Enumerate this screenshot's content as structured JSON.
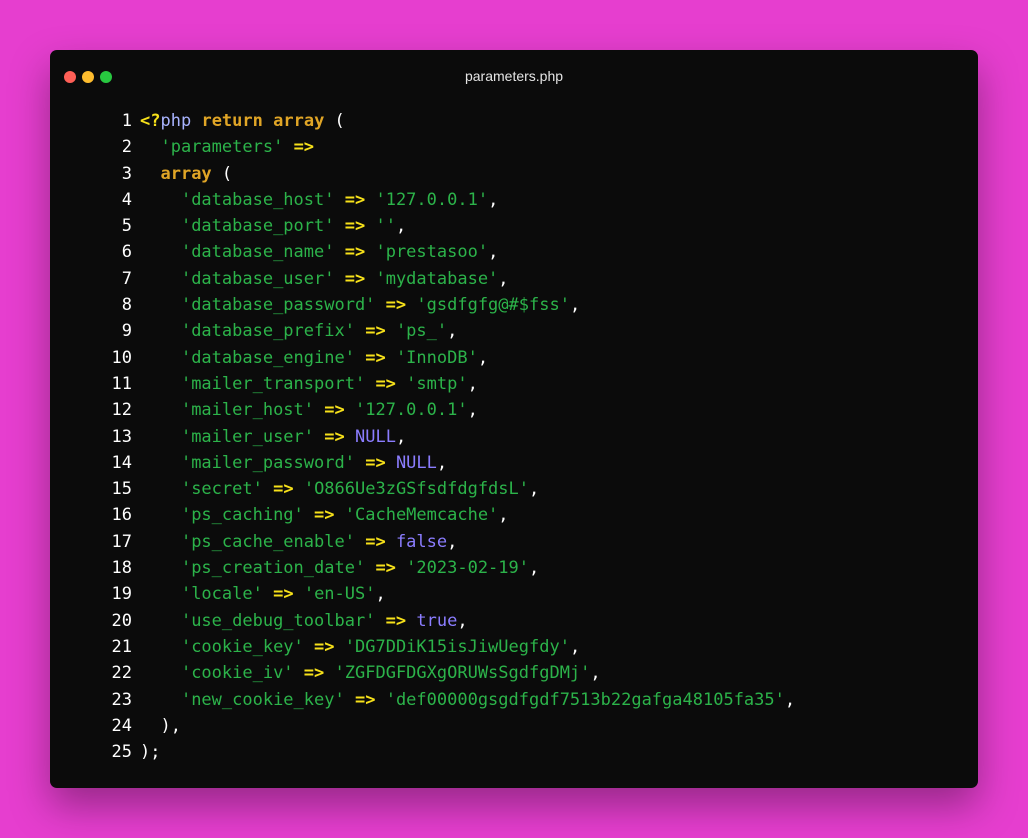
{
  "window": {
    "title": "parameters.php"
  },
  "colors": {
    "background": "#e63ecf",
    "window": "#0b0b0b",
    "string": "#2cb34a",
    "operator": "#f7e11a",
    "keyword": "#e0a526",
    "constant": "#8b7dff"
  },
  "code": {
    "lines": [
      {
        "n": "1",
        "tokens": [
          {
            "t": "<?",
            "c": "tag"
          },
          {
            "t": "php",
            "c": "php"
          },
          {
            "t": " ",
            "c": "punc"
          },
          {
            "t": "return",
            "c": "kw"
          },
          {
            "t": " ",
            "c": "punc"
          },
          {
            "t": "array",
            "c": "kw"
          },
          {
            "t": " (",
            "c": "punc"
          }
        ]
      },
      {
        "n": "2",
        "tokens": [
          {
            "t": "  ",
            "c": "punc"
          },
          {
            "t": "'parameters'",
            "c": "str"
          },
          {
            "t": " ",
            "c": "punc"
          },
          {
            "t": "=>",
            "c": "op"
          }
        ]
      },
      {
        "n": "3",
        "tokens": [
          {
            "t": "  ",
            "c": "punc"
          },
          {
            "t": "array",
            "c": "kw"
          },
          {
            "t": " (",
            "c": "punc"
          }
        ]
      },
      {
        "n": "4",
        "tokens": [
          {
            "t": "    ",
            "c": "punc"
          },
          {
            "t": "'database_host'",
            "c": "str"
          },
          {
            "t": " ",
            "c": "punc"
          },
          {
            "t": "=>",
            "c": "op"
          },
          {
            "t": " ",
            "c": "punc"
          },
          {
            "t": "'127.0.0.1'",
            "c": "str"
          },
          {
            "t": ",",
            "c": "punc"
          }
        ]
      },
      {
        "n": "5",
        "tokens": [
          {
            "t": "    ",
            "c": "punc"
          },
          {
            "t": "'database_port'",
            "c": "str"
          },
          {
            "t": " ",
            "c": "punc"
          },
          {
            "t": "=>",
            "c": "op"
          },
          {
            "t": " ",
            "c": "punc"
          },
          {
            "t": "''",
            "c": "str"
          },
          {
            "t": ",",
            "c": "punc"
          }
        ]
      },
      {
        "n": "6",
        "tokens": [
          {
            "t": "    ",
            "c": "punc"
          },
          {
            "t": "'database_name'",
            "c": "str"
          },
          {
            "t": " ",
            "c": "punc"
          },
          {
            "t": "=>",
            "c": "op"
          },
          {
            "t": " ",
            "c": "punc"
          },
          {
            "t": "'prestasoo'",
            "c": "str"
          },
          {
            "t": ",",
            "c": "punc"
          }
        ]
      },
      {
        "n": "7",
        "tokens": [
          {
            "t": "    ",
            "c": "punc"
          },
          {
            "t": "'database_user'",
            "c": "str"
          },
          {
            "t": " ",
            "c": "punc"
          },
          {
            "t": "=>",
            "c": "op"
          },
          {
            "t": " ",
            "c": "punc"
          },
          {
            "t": "'mydatabase'",
            "c": "str"
          },
          {
            "t": ",",
            "c": "punc"
          }
        ]
      },
      {
        "n": "8",
        "tokens": [
          {
            "t": "    ",
            "c": "punc"
          },
          {
            "t": "'database_password'",
            "c": "str"
          },
          {
            "t": " ",
            "c": "punc"
          },
          {
            "t": "=>",
            "c": "op"
          },
          {
            "t": " ",
            "c": "punc"
          },
          {
            "t": "'gsdfgfg@#$fss'",
            "c": "str"
          },
          {
            "t": ",",
            "c": "punc"
          }
        ]
      },
      {
        "n": "9",
        "tokens": [
          {
            "t": "    ",
            "c": "punc"
          },
          {
            "t": "'database_prefix'",
            "c": "str"
          },
          {
            "t": " ",
            "c": "punc"
          },
          {
            "t": "=>",
            "c": "op"
          },
          {
            "t": " ",
            "c": "punc"
          },
          {
            "t": "'ps_'",
            "c": "str"
          },
          {
            "t": ",",
            "c": "punc"
          }
        ]
      },
      {
        "n": "10",
        "tokens": [
          {
            "t": "    ",
            "c": "punc"
          },
          {
            "t": "'database_engine'",
            "c": "str"
          },
          {
            "t": " ",
            "c": "punc"
          },
          {
            "t": "=>",
            "c": "op"
          },
          {
            "t": " ",
            "c": "punc"
          },
          {
            "t": "'InnoDB'",
            "c": "str"
          },
          {
            "t": ",",
            "c": "punc"
          }
        ]
      },
      {
        "n": "11",
        "tokens": [
          {
            "t": "    ",
            "c": "punc"
          },
          {
            "t": "'mailer_transport'",
            "c": "str"
          },
          {
            "t": " ",
            "c": "punc"
          },
          {
            "t": "=>",
            "c": "op"
          },
          {
            "t": " ",
            "c": "punc"
          },
          {
            "t": "'smtp'",
            "c": "str"
          },
          {
            "t": ",",
            "c": "punc"
          }
        ]
      },
      {
        "n": "12",
        "tokens": [
          {
            "t": "    ",
            "c": "punc"
          },
          {
            "t": "'mailer_host'",
            "c": "str"
          },
          {
            "t": " ",
            "c": "punc"
          },
          {
            "t": "=>",
            "c": "op"
          },
          {
            "t": " ",
            "c": "punc"
          },
          {
            "t": "'127.0.0.1'",
            "c": "str"
          },
          {
            "t": ",",
            "c": "punc"
          }
        ]
      },
      {
        "n": "13",
        "tokens": [
          {
            "t": "    ",
            "c": "punc"
          },
          {
            "t": "'mailer_user'",
            "c": "str"
          },
          {
            "t": " ",
            "c": "punc"
          },
          {
            "t": "=>",
            "c": "op"
          },
          {
            "t": " ",
            "c": "punc"
          },
          {
            "t": "NULL",
            "c": "const"
          },
          {
            "t": ",",
            "c": "punc"
          }
        ]
      },
      {
        "n": "14",
        "tokens": [
          {
            "t": "    ",
            "c": "punc"
          },
          {
            "t": "'mailer_password'",
            "c": "str"
          },
          {
            "t": " ",
            "c": "punc"
          },
          {
            "t": "=>",
            "c": "op"
          },
          {
            "t": " ",
            "c": "punc"
          },
          {
            "t": "NULL",
            "c": "const"
          },
          {
            "t": ",",
            "c": "punc"
          }
        ]
      },
      {
        "n": "15",
        "tokens": [
          {
            "t": "    ",
            "c": "punc"
          },
          {
            "t": "'secret'",
            "c": "str"
          },
          {
            "t": " ",
            "c": "punc"
          },
          {
            "t": "=>",
            "c": "op"
          },
          {
            "t": " ",
            "c": "punc"
          },
          {
            "t": "'O866Ue3zGSfsdfdgfdsL'",
            "c": "str"
          },
          {
            "t": ",",
            "c": "punc"
          }
        ]
      },
      {
        "n": "16",
        "tokens": [
          {
            "t": "    ",
            "c": "punc"
          },
          {
            "t": "'ps_caching'",
            "c": "str"
          },
          {
            "t": " ",
            "c": "punc"
          },
          {
            "t": "=>",
            "c": "op"
          },
          {
            "t": " ",
            "c": "punc"
          },
          {
            "t": "'CacheMemcache'",
            "c": "str"
          },
          {
            "t": ",",
            "c": "punc"
          }
        ]
      },
      {
        "n": "17",
        "tokens": [
          {
            "t": "    ",
            "c": "punc"
          },
          {
            "t": "'ps_cache_enable'",
            "c": "str"
          },
          {
            "t": " ",
            "c": "punc"
          },
          {
            "t": "=>",
            "c": "op"
          },
          {
            "t": " ",
            "c": "punc"
          },
          {
            "t": "false",
            "c": "const"
          },
          {
            "t": ",",
            "c": "punc"
          }
        ]
      },
      {
        "n": "18",
        "tokens": [
          {
            "t": "    ",
            "c": "punc"
          },
          {
            "t": "'ps_creation_date'",
            "c": "str"
          },
          {
            "t": " ",
            "c": "punc"
          },
          {
            "t": "=>",
            "c": "op"
          },
          {
            "t": " ",
            "c": "punc"
          },
          {
            "t": "'2023-02-19'",
            "c": "str"
          },
          {
            "t": ",",
            "c": "punc"
          }
        ]
      },
      {
        "n": "19",
        "tokens": [
          {
            "t": "    ",
            "c": "punc"
          },
          {
            "t": "'locale'",
            "c": "str"
          },
          {
            "t": " ",
            "c": "punc"
          },
          {
            "t": "=>",
            "c": "op"
          },
          {
            "t": " ",
            "c": "punc"
          },
          {
            "t": "'en-US'",
            "c": "str"
          },
          {
            "t": ",",
            "c": "punc"
          }
        ]
      },
      {
        "n": "20",
        "tokens": [
          {
            "t": "    ",
            "c": "punc"
          },
          {
            "t": "'use_debug_toolbar'",
            "c": "str"
          },
          {
            "t": " ",
            "c": "punc"
          },
          {
            "t": "=>",
            "c": "op"
          },
          {
            "t": " ",
            "c": "punc"
          },
          {
            "t": "true",
            "c": "const"
          },
          {
            "t": ",",
            "c": "punc"
          }
        ]
      },
      {
        "n": "21",
        "tokens": [
          {
            "t": "    ",
            "c": "punc"
          },
          {
            "t": "'cookie_key'",
            "c": "str"
          },
          {
            "t": " ",
            "c": "punc"
          },
          {
            "t": "=>",
            "c": "op"
          },
          {
            "t": " ",
            "c": "punc"
          },
          {
            "t": "'DG7DDiK15isJiwUegfdy'",
            "c": "str"
          },
          {
            "t": ",",
            "c": "punc"
          }
        ]
      },
      {
        "n": "22",
        "tokens": [
          {
            "t": "    ",
            "c": "punc"
          },
          {
            "t": "'cookie_iv'",
            "c": "str"
          },
          {
            "t": " ",
            "c": "punc"
          },
          {
            "t": "=>",
            "c": "op"
          },
          {
            "t": " ",
            "c": "punc"
          },
          {
            "t": "'ZGFDGFDGXgORUWsSgdfgDMj'",
            "c": "str"
          },
          {
            "t": ",",
            "c": "punc"
          }
        ]
      },
      {
        "n": "23",
        "tokens": [
          {
            "t": "    ",
            "c": "punc"
          },
          {
            "t": "'new_cookie_key'",
            "c": "str"
          },
          {
            "t": " ",
            "c": "punc"
          },
          {
            "t": "=>",
            "c": "op"
          },
          {
            "t": " ",
            "c": "punc"
          },
          {
            "t": "'def00000gsgdfgdf7513b22gafga48105fa35'",
            "c": "str"
          },
          {
            "t": ",",
            "c": "punc"
          }
        ]
      },
      {
        "n": "24",
        "tokens": [
          {
            "t": "  ),",
            "c": "punc"
          }
        ]
      },
      {
        "n": "25",
        "tokens": [
          {
            "t": ");",
            "c": "punc"
          }
        ]
      }
    ]
  }
}
